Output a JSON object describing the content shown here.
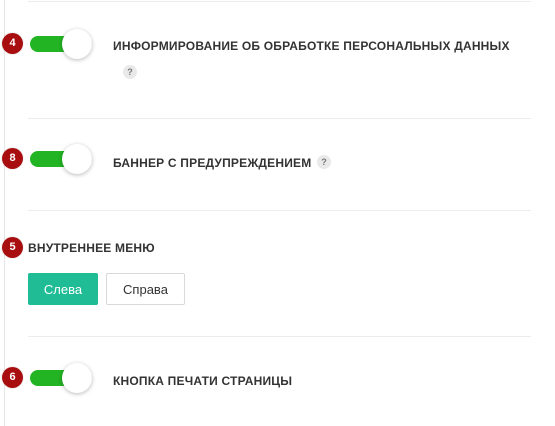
{
  "colors": {
    "badge": "#a80d10",
    "toggle_on": "#22b422",
    "button_active": "#1fbc96"
  },
  "settings": [
    {
      "badge": "4",
      "label": "ИНФОРМИРОВАНИЕ ОБ ОБРАБОТКЕ ПЕРСОНАЛЬНЫХ ДАННЫХ",
      "toggle_on": true,
      "help": "?"
    },
    {
      "badge": "8",
      "label": "БАННЕР С ПРЕДУПРЕЖДЕНИЕМ",
      "toggle_on": true,
      "help": "?"
    },
    {
      "badge": "5",
      "label": "ВНУТРЕННЕЕ МЕНЮ",
      "options": [
        "Слева",
        "Справа"
      ],
      "selected": "Слева"
    },
    {
      "badge": "6",
      "label": "КНОПКА ПЕЧАТИ СТРАНИЦЫ",
      "toggle_on": true
    }
  ]
}
